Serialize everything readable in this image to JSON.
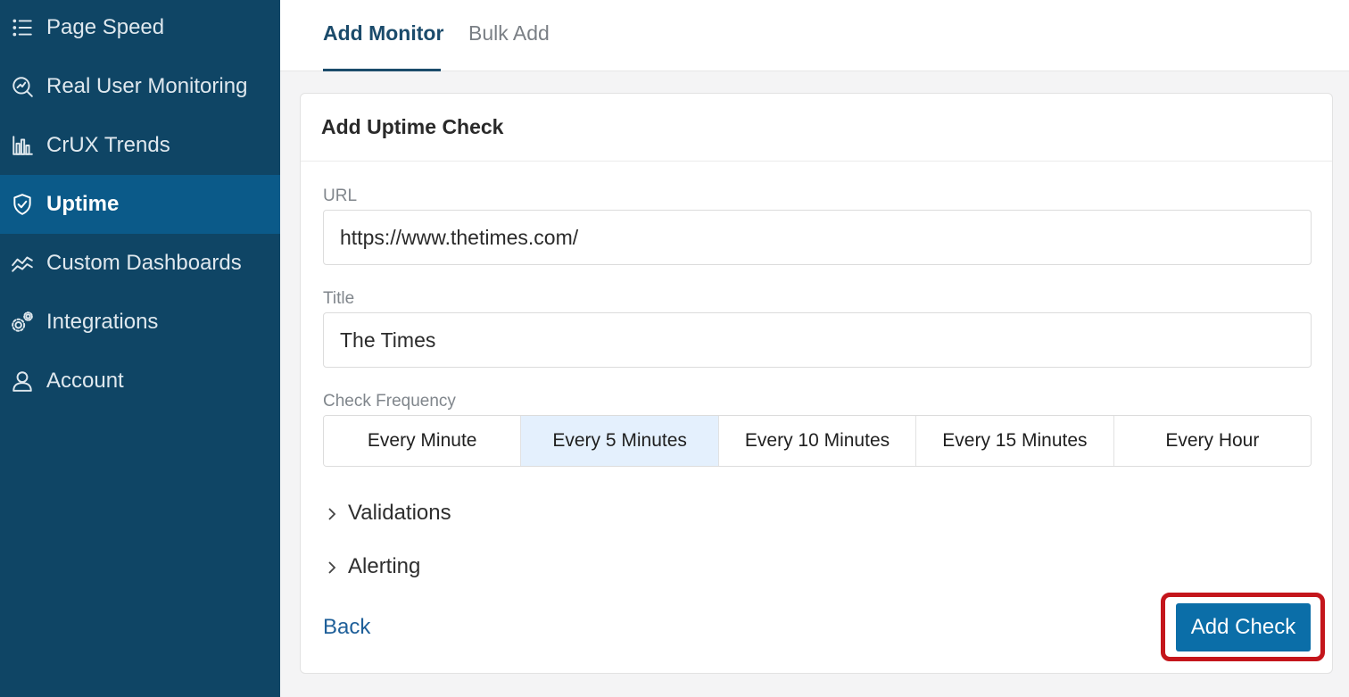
{
  "sidebar": {
    "items": [
      {
        "label": "Page Speed",
        "icon": "list-icon",
        "active": false
      },
      {
        "label": "Real User Monitoring",
        "icon": "gauge-search-icon",
        "active": false
      },
      {
        "label": "CrUX Trends",
        "icon": "bar-chart-icon",
        "active": false
      },
      {
        "label": "Uptime",
        "icon": "shield-check-icon",
        "active": true
      },
      {
        "label": "Custom Dashboards",
        "icon": "trend-lines-icon",
        "active": false
      },
      {
        "label": "Integrations",
        "icon": "gears-icon",
        "active": false
      },
      {
        "label": "Account",
        "icon": "user-icon",
        "active": false
      }
    ]
  },
  "tabs": [
    {
      "label": "Add Monitor",
      "active": true
    },
    {
      "label": "Bulk Add",
      "active": false
    }
  ],
  "card": {
    "title": "Add Uptime Check",
    "url": {
      "label": "URL",
      "value": "https://www.thetimes.com/"
    },
    "title_field": {
      "label": "Title",
      "value": "The Times"
    },
    "frequency": {
      "label": "Check Frequency",
      "options": [
        "Every Minute",
        "Every 5 Minutes",
        "Every 10 Minutes",
        "Every 15 Minutes",
        "Every Hour"
      ],
      "selected": "Every 5 Minutes"
    },
    "sections": [
      "Validations",
      "Alerting"
    ],
    "back_label": "Back",
    "submit_label": "Add Check"
  },
  "colors": {
    "sidebar_bg": "#0f4565",
    "sidebar_active": "#0b5a89",
    "accent": "#0b6ea8",
    "highlight": "#c4161c",
    "selected_option": "#e4f0fd"
  }
}
